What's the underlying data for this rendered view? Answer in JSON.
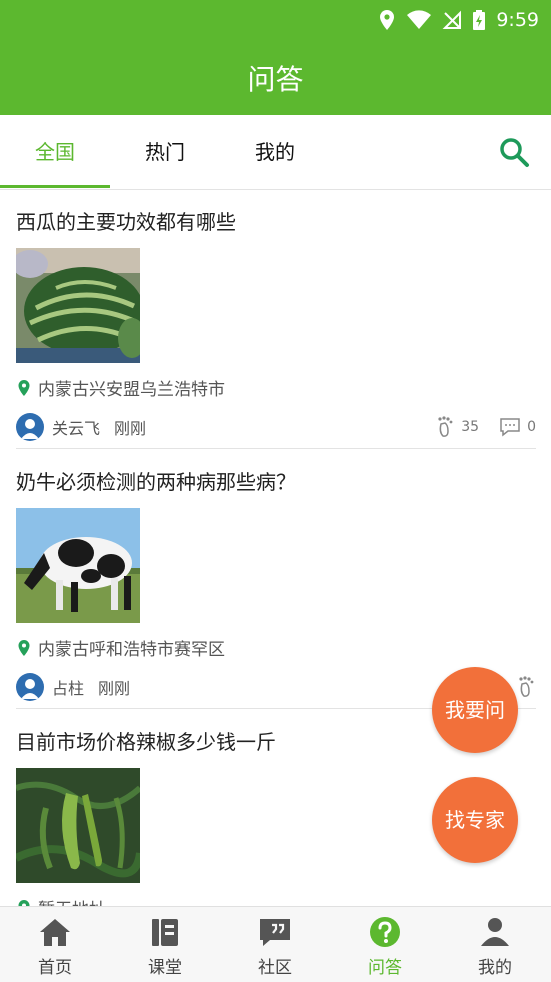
{
  "status_bar": {
    "time": "9:59"
  },
  "header": {
    "title": "问答"
  },
  "tabs": [
    {
      "label": "全国",
      "active": true
    },
    {
      "label": "热门",
      "active": false
    },
    {
      "label": "我的",
      "active": false
    }
  ],
  "posts": [
    {
      "title": "西瓜的主要功效都有哪些",
      "image": "watermelon",
      "location": "内蒙古兴安盟乌兰浩特市",
      "author": "关云飞",
      "time": "刚刚",
      "views": "35",
      "comments": "0"
    },
    {
      "title": "奶牛必须检测的两种病那些病？",
      "image": "cow",
      "location": "内蒙古呼和浩特市赛罕区",
      "author": "占柱",
      "time": "刚刚"
    },
    {
      "title": "目前市场价格辣椒多少钱一斤",
      "image": "pepper",
      "location": "暂无地址"
    }
  ],
  "fabs": {
    "ask": "我要问",
    "expert": "找专家"
  },
  "bottom_nav": [
    {
      "label": "首页",
      "icon": "home-icon"
    },
    {
      "label": "课堂",
      "icon": "book-icon"
    },
    {
      "label": "社区",
      "icon": "chat-icon"
    },
    {
      "label": "问答",
      "icon": "question-icon",
      "active": true
    },
    {
      "label": "我的",
      "icon": "profile-icon"
    }
  ],
  "colors": {
    "primary": "#5cb82f",
    "fab": "#f2703a",
    "divider": "#e3e3e3"
  }
}
